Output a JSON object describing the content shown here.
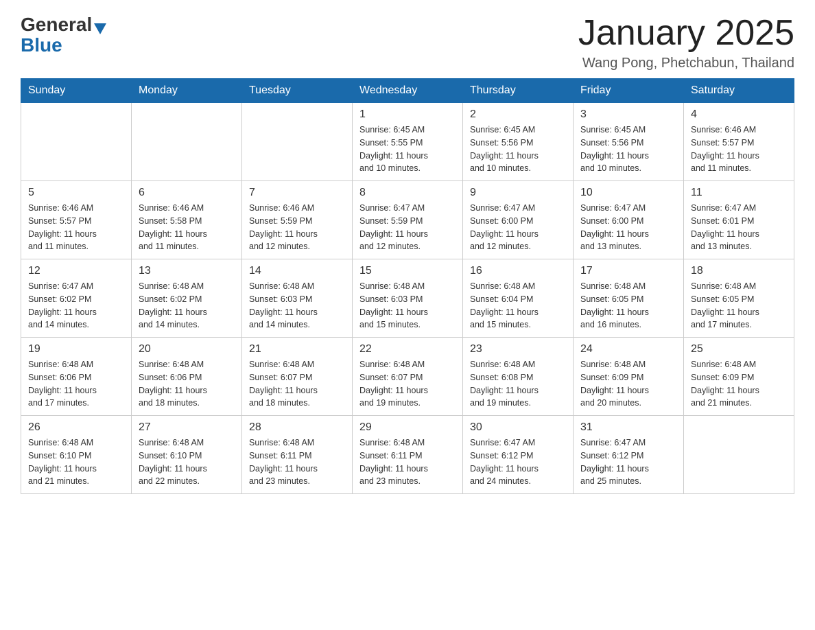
{
  "logo": {
    "general": "General",
    "blue": "Blue",
    "arrow": "▲"
  },
  "title": "January 2025",
  "subtitle": "Wang Pong, Phetchabun, Thailand",
  "days_of_week": [
    "Sunday",
    "Monday",
    "Tuesday",
    "Wednesday",
    "Thursday",
    "Friday",
    "Saturday"
  ],
  "weeks": [
    [
      {
        "day": "",
        "info": ""
      },
      {
        "day": "",
        "info": ""
      },
      {
        "day": "",
        "info": ""
      },
      {
        "day": "1",
        "info": "Sunrise: 6:45 AM\nSunset: 5:55 PM\nDaylight: 11 hours\nand 10 minutes."
      },
      {
        "day": "2",
        "info": "Sunrise: 6:45 AM\nSunset: 5:56 PM\nDaylight: 11 hours\nand 10 minutes."
      },
      {
        "day": "3",
        "info": "Sunrise: 6:45 AM\nSunset: 5:56 PM\nDaylight: 11 hours\nand 10 minutes."
      },
      {
        "day": "4",
        "info": "Sunrise: 6:46 AM\nSunset: 5:57 PM\nDaylight: 11 hours\nand 11 minutes."
      }
    ],
    [
      {
        "day": "5",
        "info": "Sunrise: 6:46 AM\nSunset: 5:57 PM\nDaylight: 11 hours\nand 11 minutes."
      },
      {
        "day": "6",
        "info": "Sunrise: 6:46 AM\nSunset: 5:58 PM\nDaylight: 11 hours\nand 11 minutes."
      },
      {
        "day": "7",
        "info": "Sunrise: 6:46 AM\nSunset: 5:59 PM\nDaylight: 11 hours\nand 12 minutes."
      },
      {
        "day": "8",
        "info": "Sunrise: 6:47 AM\nSunset: 5:59 PM\nDaylight: 11 hours\nand 12 minutes."
      },
      {
        "day": "9",
        "info": "Sunrise: 6:47 AM\nSunset: 6:00 PM\nDaylight: 11 hours\nand 12 minutes."
      },
      {
        "day": "10",
        "info": "Sunrise: 6:47 AM\nSunset: 6:00 PM\nDaylight: 11 hours\nand 13 minutes."
      },
      {
        "day": "11",
        "info": "Sunrise: 6:47 AM\nSunset: 6:01 PM\nDaylight: 11 hours\nand 13 minutes."
      }
    ],
    [
      {
        "day": "12",
        "info": "Sunrise: 6:47 AM\nSunset: 6:02 PM\nDaylight: 11 hours\nand 14 minutes."
      },
      {
        "day": "13",
        "info": "Sunrise: 6:48 AM\nSunset: 6:02 PM\nDaylight: 11 hours\nand 14 minutes."
      },
      {
        "day": "14",
        "info": "Sunrise: 6:48 AM\nSunset: 6:03 PM\nDaylight: 11 hours\nand 14 minutes."
      },
      {
        "day": "15",
        "info": "Sunrise: 6:48 AM\nSunset: 6:03 PM\nDaylight: 11 hours\nand 15 minutes."
      },
      {
        "day": "16",
        "info": "Sunrise: 6:48 AM\nSunset: 6:04 PM\nDaylight: 11 hours\nand 15 minutes."
      },
      {
        "day": "17",
        "info": "Sunrise: 6:48 AM\nSunset: 6:05 PM\nDaylight: 11 hours\nand 16 minutes."
      },
      {
        "day": "18",
        "info": "Sunrise: 6:48 AM\nSunset: 6:05 PM\nDaylight: 11 hours\nand 17 minutes."
      }
    ],
    [
      {
        "day": "19",
        "info": "Sunrise: 6:48 AM\nSunset: 6:06 PM\nDaylight: 11 hours\nand 17 minutes."
      },
      {
        "day": "20",
        "info": "Sunrise: 6:48 AM\nSunset: 6:06 PM\nDaylight: 11 hours\nand 18 minutes."
      },
      {
        "day": "21",
        "info": "Sunrise: 6:48 AM\nSunset: 6:07 PM\nDaylight: 11 hours\nand 18 minutes."
      },
      {
        "day": "22",
        "info": "Sunrise: 6:48 AM\nSunset: 6:07 PM\nDaylight: 11 hours\nand 19 minutes."
      },
      {
        "day": "23",
        "info": "Sunrise: 6:48 AM\nSunset: 6:08 PM\nDaylight: 11 hours\nand 19 minutes."
      },
      {
        "day": "24",
        "info": "Sunrise: 6:48 AM\nSunset: 6:09 PM\nDaylight: 11 hours\nand 20 minutes."
      },
      {
        "day": "25",
        "info": "Sunrise: 6:48 AM\nSunset: 6:09 PM\nDaylight: 11 hours\nand 21 minutes."
      }
    ],
    [
      {
        "day": "26",
        "info": "Sunrise: 6:48 AM\nSunset: 6:10 PM\nDaylight: 11 hours\nand 21 minutes."
      },
      {
        "day": "27",
        "info": "Sunrise: 6:48 AM\nSunset: 6:10 PM\nDaylight: 11 hours\nand 22 minutes."
      },
      {
        "day": "28",
        "info": "Sunrise: 6:48 AM\nSunset: 6:11 PM\nDaylight: 11 hours\nand 23 minutes."
      },
      {
        "day": "29",
        "info": "Sunrise: 6:48 AM\nSunset: 6:11 PM\nDaylight: 11 hours\nand 23 minutes."
      },
      {
        "day": "30",
        "info": "Sunrise: 6:47 AM\nSunset: 6:12 PM\nDaylight: 11 hours\nand 24 minutes."
      },
      {
        "day": "31",
        "info": "Sunrise: 6:47 AM\nSunset: 6:12 PM\nDaylight: 11 hours\nand 25 minutes."
      },
      {
        "day": "",
        "info": ""
      }
    ]
  ]
}
